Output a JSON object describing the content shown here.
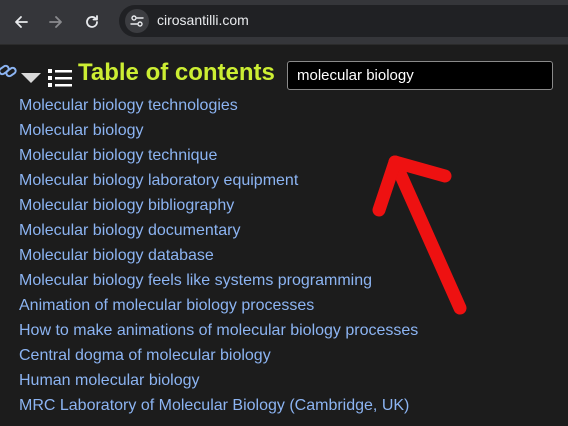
{
  "browser": {
    "url": "cirosantilli.com",
    "icons": [
      "back-arrow-icon",
      "forward-arrow-icon",
      "reload-icon",
      "site-settings-icon"
    ]
  },
  "toc": {
    "title": "Table of contents",
    "search_value": "molecular biology",
    "icons": [
      "link-icon",
      "caret-down-icon",
      "list-icon"
    ],
    "items": [
      "Molecular biology technologies",
      "Molecular biology",
      "Molecular biology technique",
      "Molecular biology laboratory equipment",
      "Molecular biology bibliography",
      "Molecular biology documentary",
      "Molecular biology database",
      "Molecular biology feels like systems programming",
      "Animation of molecular biology processes",
      "How to make animations of molecular biology processes",
      "Central dogma of molecular biology",
      "Human molecular biology",
      "MRC Laboratory of Molecular Biology (Cambridge, UK)"
    ]
  },
  "annotation": {
    "icon": "red-arrow-icon",
    "color": "#ee1111"
  },
  "colors": {
    "title": "#ccee33",
    "link": "#8cb4f2",
    "background": "#1c1c1c",
    "toolbar": "#35363a"
  }
}
